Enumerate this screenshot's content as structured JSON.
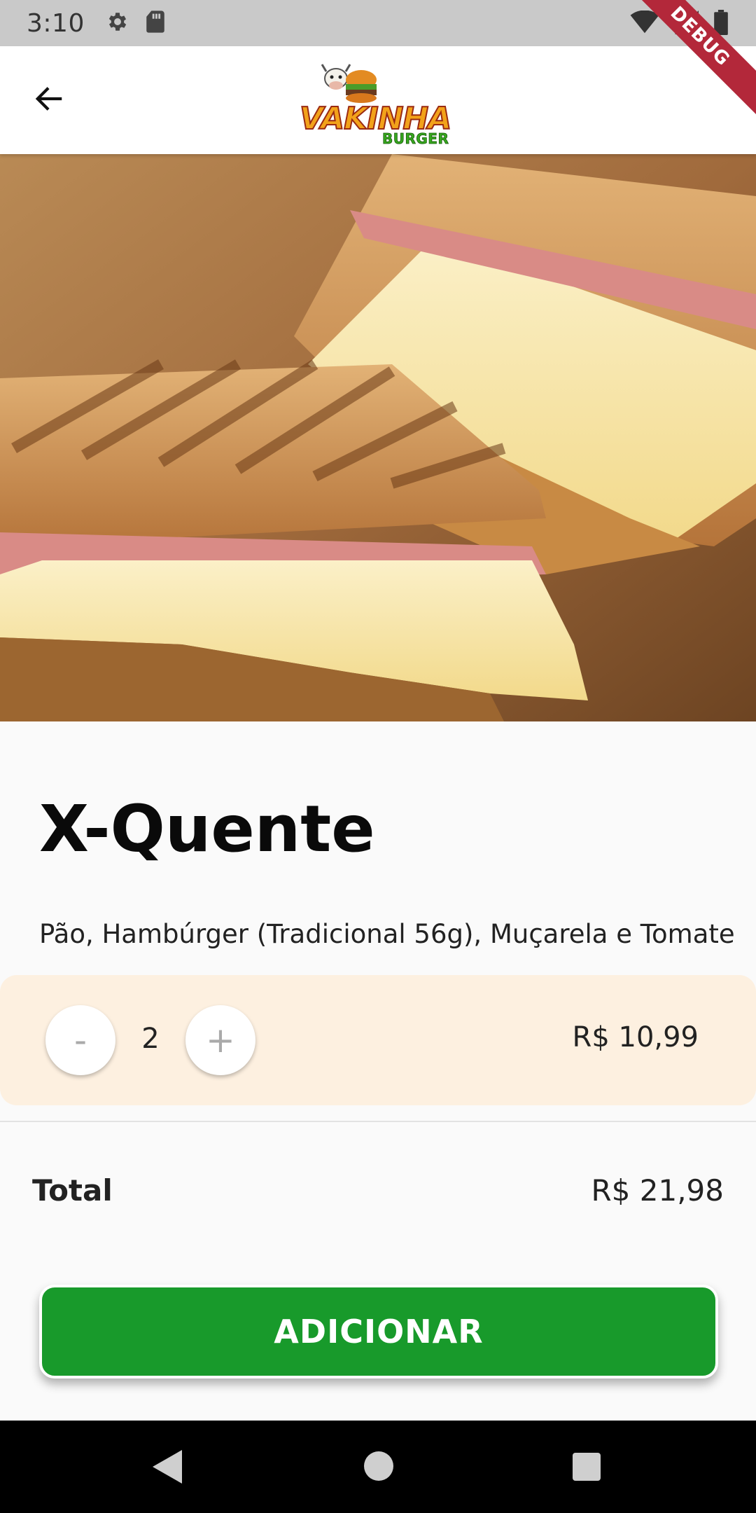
{
  "status_bar": {
    "time": "3:10"
  },
  "debug_banner": "DEBUG",
  "app_bar": {
    "logo_main": "VAKINHA",
    "logo_sub": "BURGER"
  },
  "product": {
    "name": "X-Quente",
    "description": "Pão, Hambúrger (Tradicional 56g), Muçarela e Tomate",
    "quantity": "2",
    "unit_price": "R$ 10,99",
    "minus_label": "-",
    "plus_label": "+"
  },
  "total": {
    "label": "Total",
    "value": "R$ 21,98"
  },
  "add_button": {
    "label": "ADICIONAR"
  },
  "colors": {
    "primary_green": "#189a2b",
    "qty_background": "#fdf0e0",
    "debug_red": "#b3283a"
  },
  "icons": [
    "settings-icon",
    "sd-card-icon",
    "wifi-icon",
    "signal-icon",
    "battery-icon",
    "back-arrow-icon",
    "nav-back-icon",
    "nav-home-icon",
    "nav-recent-icon"
  ]
}
